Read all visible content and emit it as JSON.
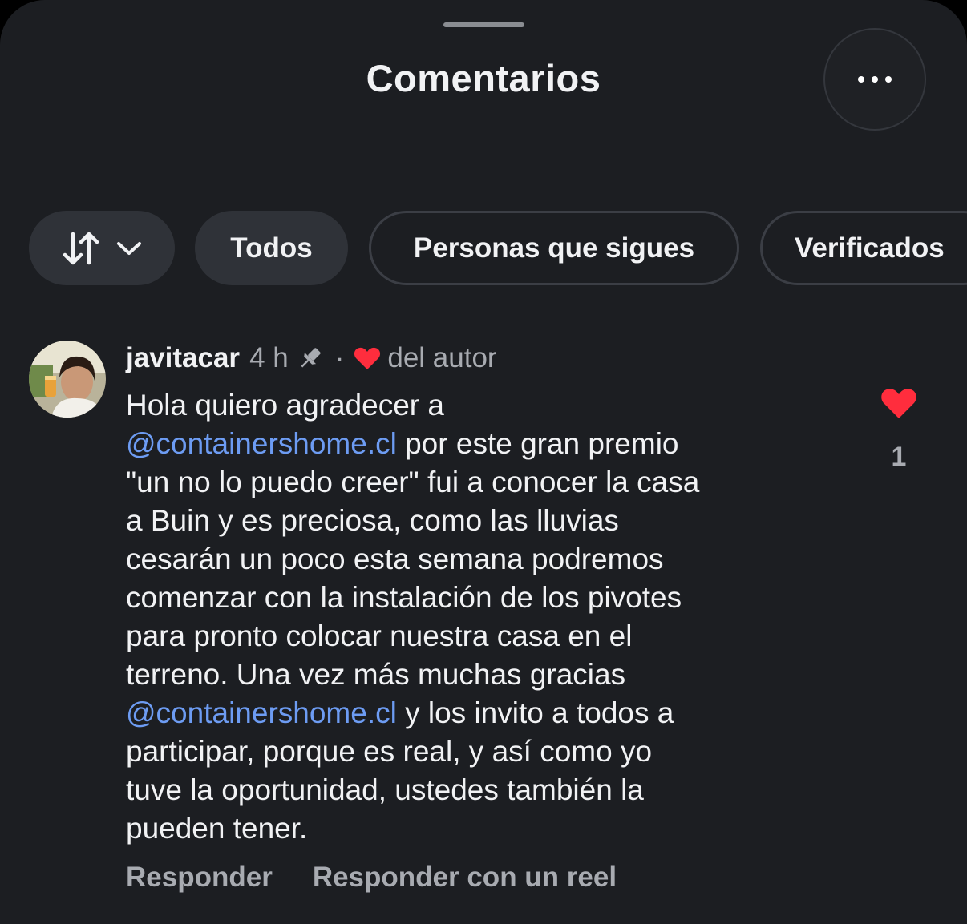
{
  "header": {
    "title": "Comentarios"
  },
  "filters": {
    "sort_icon": "sort-arrows-icon",
    "chevron_icon": "chevron-down-icon",
    "items": [
      {
        "label": "Todos",
        "selected": true
      },
      {
        "label": "Personas que sigues",
        "selected": false
      },
      {
        "label": "Verificados",
        "selected": false
      }
    ]
  },
  "comment": {
    "username": "javitacar",
    "time": "4 h",
    "pinned_icon": "pin-icon",
    "separator": "·",
    "author_liked_label": "del autor",
    "lines": [
      {
        "text": "Hola quiero agradecer a"
      },
      {
        "mention": "@containershome.cl",
        "text": " por este gran premio"
      },
      {
        "text": "\"un no lo puedo creer\" fui a conocer la casa"
      },
      {
        "text": "a Buin y es preciosa, como las lluvias"
      },
      {
        "text": "cesarán un poco esta semana podremos"
      },
      {
        "text": "comenzar con la instalación de los pivotes"
      },
      {
        "text": "para pronto colocar nuestra casa en el"
      },
      {
        "text": "terreno. Una vez más muchas gracias"
      },
      {
        "mention": "@containershome.cl",
        "text": " y los invito a todos a"
      },
      {
        "text": "participar, porque es real, y así como yo"
      },
      {
        "text": "tuve la oportunidad, ustedes también la"
      },
      {
        "text": "pueden tener."
      }
    ],
    "like_count": "1",
    "reply_label": "Responder",
    "reel_reply_label": "Responder con un reel"
  },
  "colors": {
    "background": "#1c1e22",
    "mention": "#6d9cf3",
    "like": "#ff2d3d",
    "secondary_text": "#a8abb1"
  }
}
